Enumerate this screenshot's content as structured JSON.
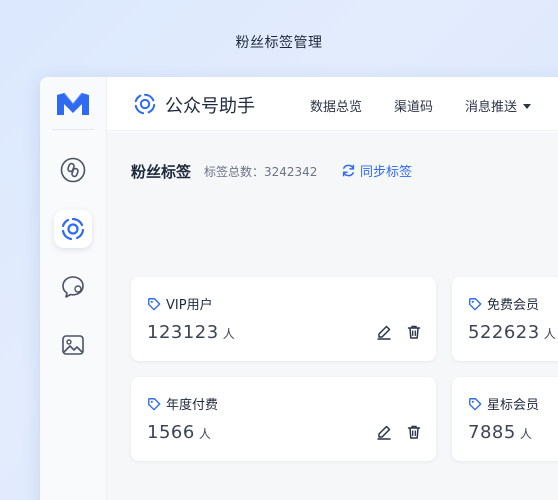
{
  "caption": "粉丝标签管理",
  "brand": {
    "title": "公众号助手"
  },
  "nav": {
    "items": [
      {
        "label": "数据总览"
      },
      {
        "label": "渠道码"
      },
      {
        "label": "消息推送",
        "has_dropdown": true
      }
    ]
  },
  "sidebar": {
    "items": [
      {
        "icon": "link-icon",
        "active": false
      },
      {
        "icon": "spiral-logo-icon",
        "active": true
      },
      {
        "icon": "chat-bubble-icon",
        "active": false
      },
      {
        "icon": "image-icon",
        "active": false
      }
    ]
  },
  "section": {
    "title": "粉丝标签",
    "total_label": "标签总数：3242342",
    "sync_label": "同步标签"
  },
  "cards": [
    {
      "name": "VIP用户",
      "count": "123123",
      "unit": "人"
    },
    {
      "name": "免费会员",
      "count": "522623",
      "unit": "人"
    },
    {
      "name": "年度付费",
      "count": "1566",
      "unit": "人"
    },
    {
      "name": "星标会员",
      "count": "7885",
      "unit": "人"
    }
  ],
  "colors": {
    "accent": "#2f6bf0",
    "logo": "#2f6bf0"
  }
}
